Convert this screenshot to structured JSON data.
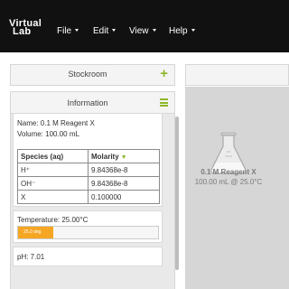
{
  "app": {
    "logo_line1": "Virtual",
    "logo_line2": "Lab"
  },
  "menu": {
    "file": "File",
    "edit": "Edit",
    "view": "View",
    "help": "Help"
  },
  "stockroom": {
    "title": "Stockroom",
    "add_icon": "plus-icon"
  },
  "information": {
    "title": "Information",
    "menu_icon": "hamburger-icon",
    "name": "Name: 0.1 M Reagent X",
    "volume": "Volume: 100.00 mL",
    "table": {
      "headers": [
        "Species (aq)",
        "Molarity"
      ],
      "rows": [
        [
          "H⁺",
          "9.84368e-8"
        ],
        [
          "OH⁻",
          "9.84368e-8"
        ],
        [
          "X",
          "0.100000"
        ]
      ]
    },
    "temperature_label": "Temperature: 25.00°C",
    "temperature_bar_text": "25.0 deg",
    "temperature_fraction": 0.25,
    "ph": "pH: 7.01"
  },
  "workbench": {
    "item_name": "0.1 M Reagent X",
    "item_detail": "100.00 mL @ 25.0°C",
    "item_icon": "erlenmeyer-flask-icon"
  },
  "colors": {
    "navbar": "#111111",
    "accent_green": "#8fb82a",
    "temperature_bar": "#f5a623"
  }
}
